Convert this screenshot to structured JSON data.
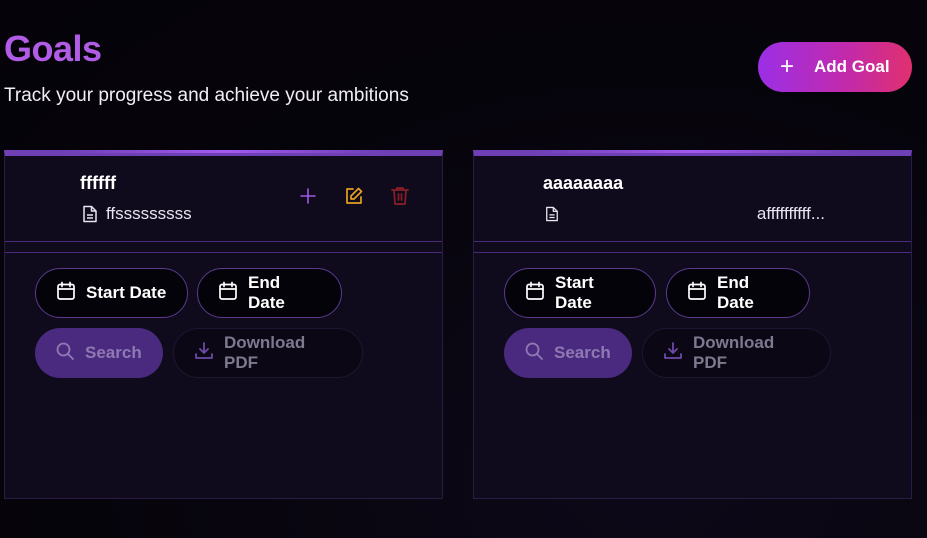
{
  "header": {
    "title": "Goals",
    "subtitle": "Track your progress and achieve your ambitions",
    "add_goal_label": "Add Goal"
  },
  "colors": {
    "title": "#b05ce6",
    "add_button_gradient": [
      "#9b2fe6",
      "#e0306e"
    ],
    "edit_icon": "#e8a020",
    "delete_icon": "#8a1f28",
    "plus_icon": "#9d5be8"
  },
  "goals": [
    {
      "title": "ffffff",
      "description": "ffsssssssss",
      "start_label": "Start Date",
      "end_label": "End Date",
      "search_label": "Search",
      "download_label": "Download PDF"
    },
    {
      "title": "aaaaaaaa",
      "description": "affffffffff...",
      "start_label": "Start Date",
      "end_label": "End Date",
      "search_label": "Search",
      "download_label": "Download PDF"
    }
  ]
}
